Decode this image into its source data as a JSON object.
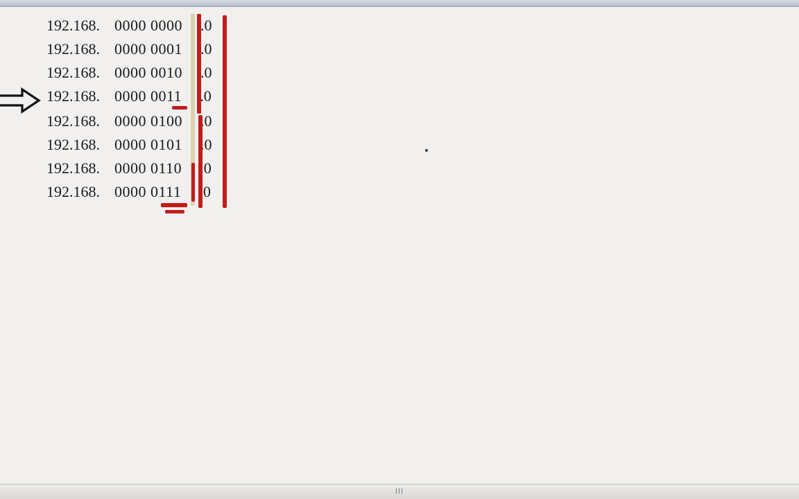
{
  "colors": {
    "annotation": "#c21c1c",
    "highlight": "#d9caa5",
    "bg": "#f1f0ee"
  },
  "arrow_row_index": 3,
  "rows": [
    {
      "prefix": "192.168.",
      "binary": "0000 0000",
      "suffix": ".0"
    },
    {
      "prefix": "192.168.",
      "binary": "0000 0001",
      "suffix": ".0"
    },
    {
      "prefix": "192.168.",
      "binary": "0000 0010",
      "suffix": ".0"
    },
    {
      "prefix": "192.168.",
      "binary": "0000 0011",
      "suffix": ".0"
    },
    {
      "prefix": "192.168.",
      "binary": "0000 0100",
      "suffix": ".0"
    },
    {
      "prefix": "192.168.",
      "binary": "0000 0101",
      "suffix": ".0"
    },
    {
      "prefix": "192.168.",
      "binary": "0000 0110",
      "suffix": ".0"
    },
    {
      "prefix": "192.168.",
      "binary": "0000 0111",
      "suffix": ".0"
    }
  ],
  "footer_grip": "III"
}
